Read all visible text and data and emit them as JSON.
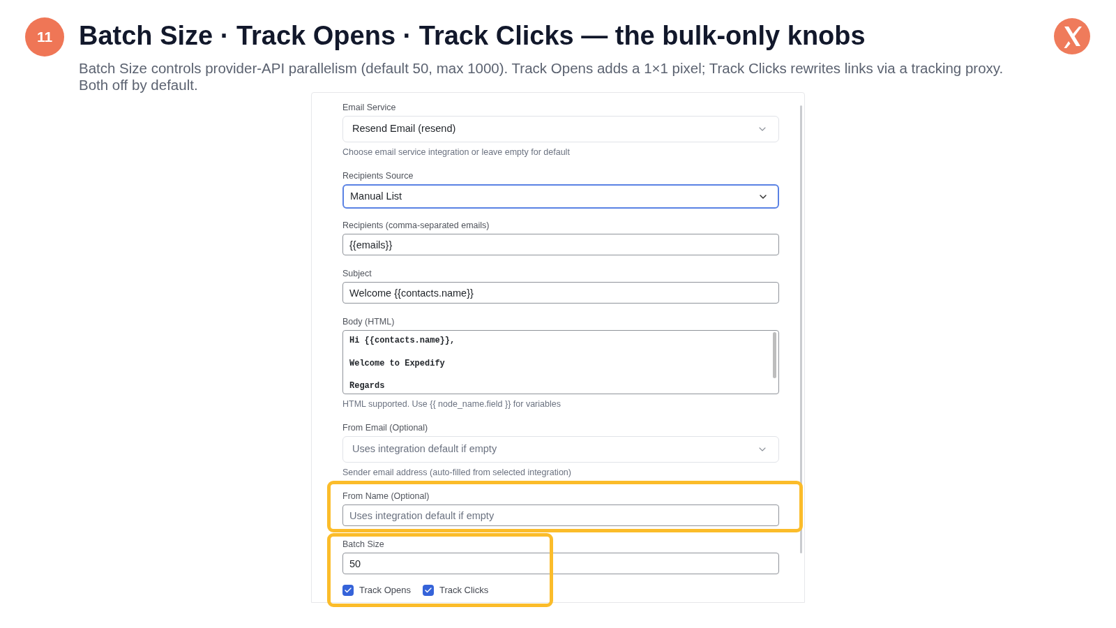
{
  "slide": {
    "number": "11",
    "title": "Batch Size · Track Opens · Track Clicks — the bulk-only knobs",
    "subtitle": "Batch Size controls provider-API parallelism (default 50, max 1000). Track Opens adds a 1×1 pixel; Track Clicks rewrites links via a tracking proxy. Both off by default."
  },
  "form": {
    "fields": [
      {
        "kind": "select",
        "label": "Email Service",
        "value": "Resend Email (resend)",
        "hint": "Choose email service integration or leave empty for default",
        "focused": false,
        "highlighted": false
      },
      {
        "kind": "select",
        "label": "Recipients Source",
        "value": "Manual List",
        "focused": true,
        "highlighted": false
      },
      {
        "kind": "input",
        "label": "Recipients (comma-separated emails)",
        "value": "{{emails}}",
        "focused": false,
        "highlighted": false
      },
      {
        "kind": "input",
        "label": "Subject",
        "value": "Welcome {{contacts.name}}",
        "focused": false,
        "highlighted": false
      },
      {
        "kind": "textarea",
        "label": "Body (HTML)",
        "value": "Hi {{contacts.name}},\n\nWelcome to Expedify\n\nRegards",
        "hint": "HTML supported. Use {{ node_name.field }} for variables",
        "focused": false,
        "highlighted": false
      },
      {
        "kind": "select",
        "label": "From Email (Optional)",
        "placeholder": "Uses integration default if empty",
        "hint": "Sender email address (auto-filled from selected integration)",
        "focused": false,
        "highlighted": false
      },
      {
        "kind": "input",
        "label": "From Name (Optional)",
        "placeholder": "Uses integration default if empty",
        "focused": false,
        "highlighted": true
      },
      {
        "kind": "batch",
        "label": "Batch Size",
        "value": "50",
        "options": [
          {
            "label": "Track Opens",
            "checked": true
          },
          {
            "label": "Track Clicks",
            "checked": true
          }
        ],
        "focused": false,
        "highlighted": true
      }
    ]
  }
}
